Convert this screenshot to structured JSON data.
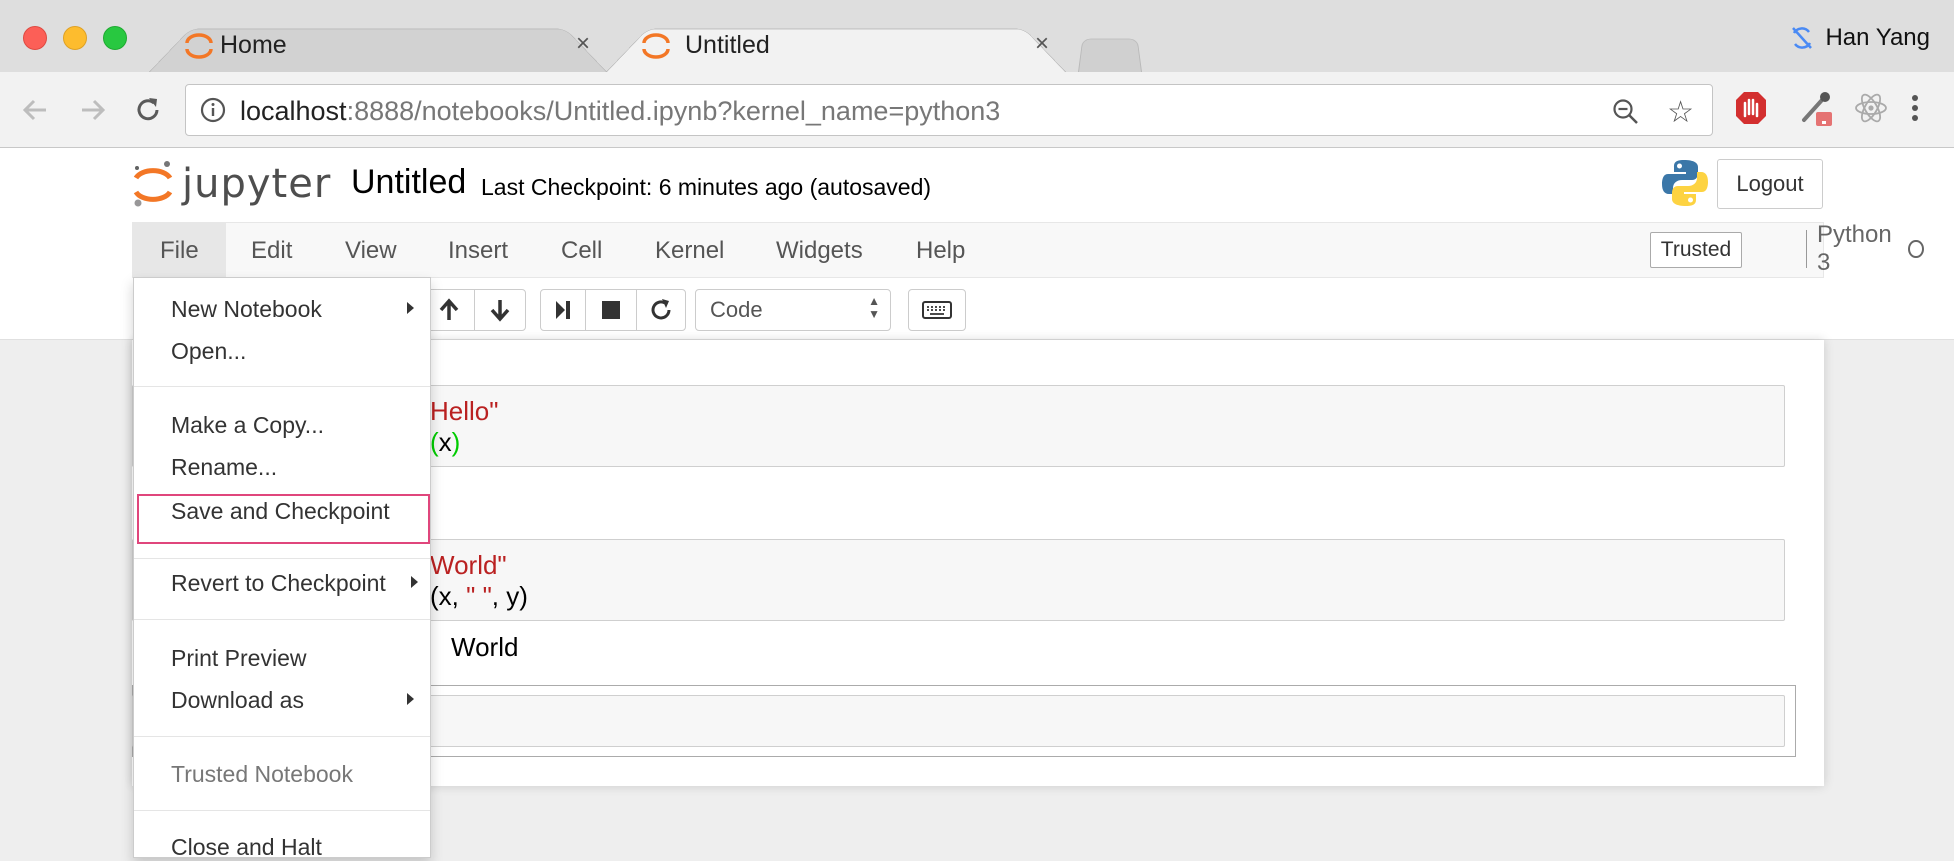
{
  "browser": {
    "tabs": [
      {
        "title": "Home",
        "close": "×"
      },
      {
        "title": "Untitled",
        "close": "×"
      }
    ],
    "profile_name": "Han Yang",
    "url_host": "localhost",
    "url_rest": ":8888/notebooks/Untitled.ipynb?kernel_name=python3"
  },
  "jupyter": {
    "logo_text": "jupyter",
    "notebook_name": "Untitled",
    "checkpoint": "Last Checkpoint: 6 minutes ago (autosaved)",
    "logout_label": "Logout",
    "menus": [
      "File",
      "Edit",
      "View",
      "Insert",
      "Cell",
      "Kernel",
      "Widgets",
      "Help"
    ],
    "trusted_label": "Trusted",
    "kernel_name": "Python 3",
    "cell_type": "Code"
  },
  "cells": {
    "cell1_line1": "Hello\"",
    "cell1_line2_open": "(",
    "cell1_line2_x": "x",
    "cell1_line2_close": ")",
    "cell2_line1": "World\"",
    "cell2_line2_a": "(x, ",
    "cell2_line2_str": "\" \"",
    "cell2_line2_b": ", y)",
    "output2": "World"
  },
  "file_menu": {
    "new_notebook": "New Notebook",
    "open": "Open...",
    "make_copy": "Make a Copy...",
    "rename": "Rename...",
    "save_checkpoint": "Save and Checkpoint",
    "revert": "Revert to Checkpoint",
    "print_preview": "Print Preview",
    "download_as": "Download as",
    "trusted_notebook": "Trusted Notebook",
    "close_halt": "Close and Halt"
  },
  "colors": {
    "jupyter_orange": "#f37726",
    "highlight_box": "#e0467c",
    "string": "#ba2121"
  }
}
